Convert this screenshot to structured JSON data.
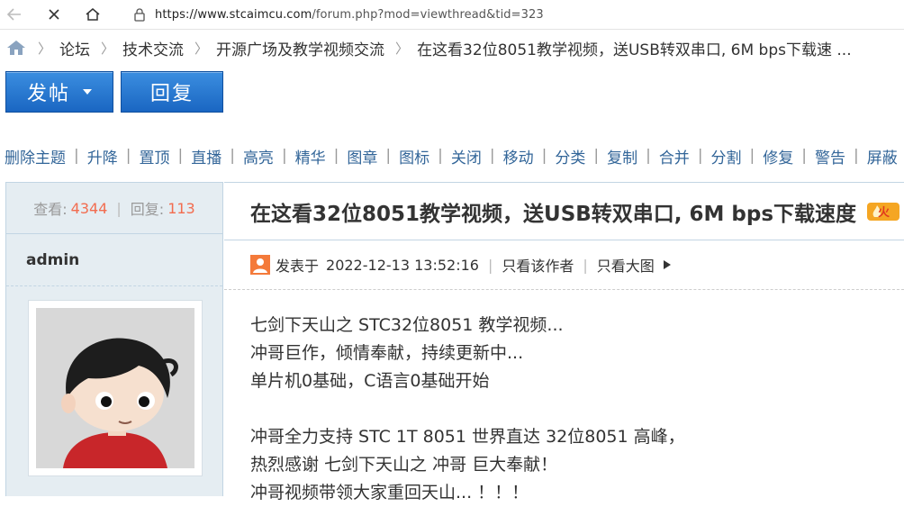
{
  "browser": {
    "url_host": "https://www.stcaimcu.com",
    "url_path": "/forum.php?mod=viewthread&tid=323"
  },
  "breadcrumb": {
    "items": [
      "论坛",
      "技术交流",
      "开源广场及教学视频交流",
      "在这看32位8051教学视频，送USB转双串口, 6M bps下载速 ..."
    ]
  },
  "actions": {
    "post_label": "发帖",
    "reply_label": "回复"
  },
  "mod_bar": {
    "items": [
      "删除主题",
      "升降",
      "置顶",
      "直播",
      "高亮",
      "精华",
      "图章",
      "图标",
      "关闭",
      "移动",
      "分类",
      "复制",
      "合并",
      "分割",
      "修复",
      "警告",
      "屏蔽"
    ]
  },
  "sidebar": {
    "views_label": "查看:",
    "views": "4344",
    "replies_label": "回复:",
    "replies": "113",
    "author": "admin"
  },
  "thread": {
    "title": "在这看32位8051教学视频，送USB转双串口, 6M bps下载速度",
    "posted_prefix": "发表于",
    "posted_at": "2022-12-13 13:52:16",
    "only_author": "只看该作者",
    "big_image": "只看大图",
    "paragraphs": [
      [
        "七剑下天山之 STC32位8051 教学视频...",
        "冲哥巨作，倾情奉献，持续更新中...",
        "单片机0基础，C语言0基础开始"
      ],
      [
        "冲哥全力支持 STC 1T 8051 世界直达 32位8051 高峰，",
        "热烈感谢 七剑下天山之 冲哥 巨大奉献！",
        "冲哥视频带领大家重回天山...  ！！！"
      ]
    ]
  },
  "colors": {
    "accent_blue": "#1a66c2",
    "link": "#336699",
    "stat_num": "#f26c4f",
    "sidebar_bg": "#e5edf2"
  }
}
